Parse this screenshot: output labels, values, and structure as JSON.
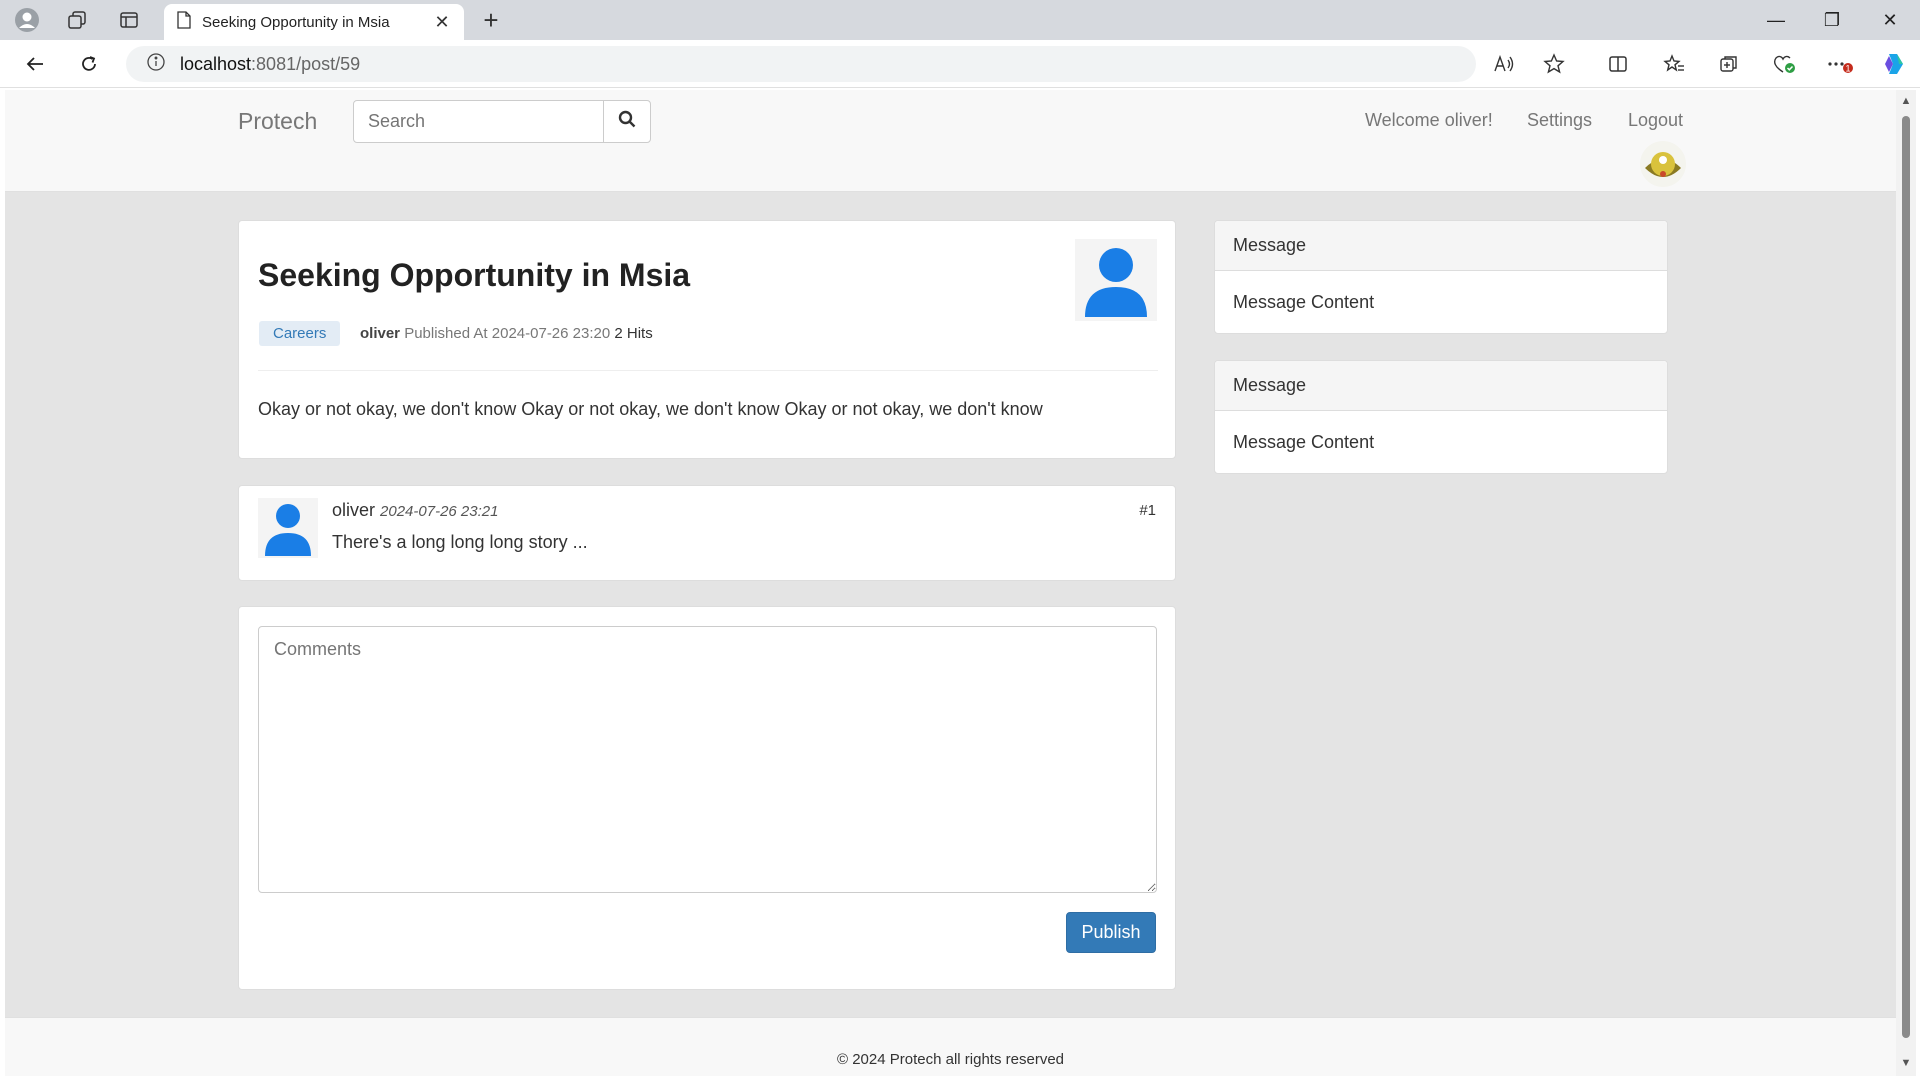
{
  "browser": {
    "tab_title": "Seeking Opportunity in Msia",
    "url_host": "localhost",
    "url_path": ":8081/post/59"
  },
  "navbar": {
    "brand": "Protech",
    "search_placeholder": "Search",
    "welcome": "Welcome oliver!",
    "settings": "Settings",
    "logout": "Logout"
  },
  "post": {
    "title": "Seeking Opportunity in Msia",
    "category": "Careers",
    "author": "oliver",
    "published_label": "Published At 2024-07-26 23:20",
    "hits": "2 Hits",
    "body": "Okay or not okay, we don't know Okay or not okay, we don't know Okay or not okay, we don't know"
  },
  "comments": [
    {
      "author": "oliver",
      "time": "2024-07-26 23:21",
      "number": "#1",
      "text": "There's a long long long story ..."
    }
  ],
  "comment_form": {
    "placeholder": "Comments",
    "publish_label": "Publish"
  },
  "sidebar": [
    {
      "title": "Message",
      "content": "Message Content"
    },
    {
      "title": "Message",
      "content": "Message Content"
    }
  ],
  "footer": {
    "text": "© 2024 Protech all rights reserved"
  },
  "colors": {
    "primary": "#337ab7",
    "page_bg": "#e4e4e4",
    "navbar_bg": "#f8f8f8",
    "avatar_blue": "#1a7ee6"
  }
}
